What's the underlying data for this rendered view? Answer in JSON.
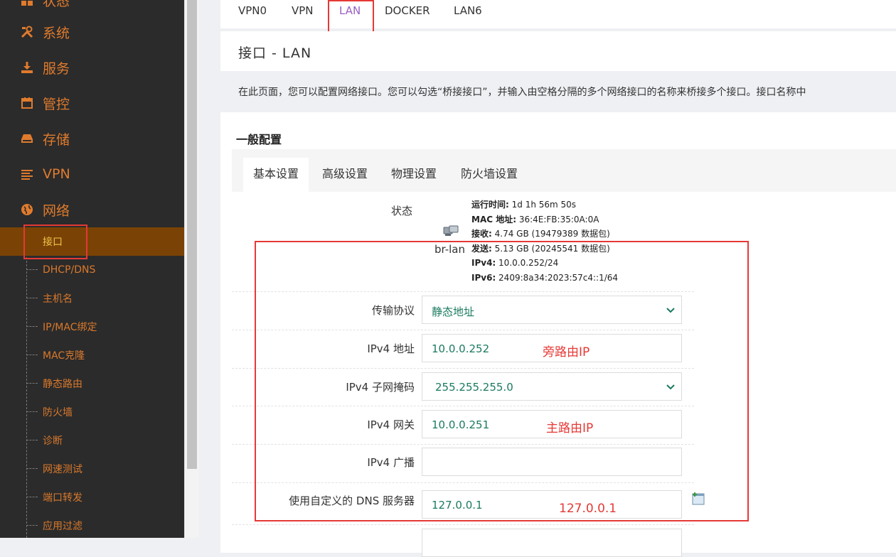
{
  "sidebar": {
    "items": [
      {
        "label": "状态",
        "icon": "dashboard-icon"
      },
      {
        "label": "系统",
        "icon": "tools-icon"
      },
      {
        "label": "服务",
        "icon": "download-icon"
      },
      {
        "label": "管控",
        "icon": "calendar-icon"
      },
      {
        "label": "存储",
        "icon": "drive-icon"
      },
      {
        "label": "VPN",
        "icon": "list-icon"
      },
      {
        "label": "网络",
        "icon": "globe-icon"
      }
    ],
    "sub_items": [
      "接口",
      "DHCP/DNS",
      "主机名",
      "IP/MAC绑定",
      "MAC克隆",
      "静态路由",
      "防火墙",
      "诊断",
      "网速测试",
      "端口转发",
      "应用过滤"
    ],
    "active_sub": "接口"
  },
  "tabs": [
    "VPN0",
    "VPN",
    "LAN",
    "DOCKER",
    "LAN6"
  ],
  "active_tab": "LAN",
  "page_title": "接口 - LAN",
  "description": "在此页面，您可以配置网络接口。您可以勾选“桥接接口”，并输入由空格分隔的多个网络接口的名称来桥接多个接口。接口名称中",
  "section_title": "一般配置",
  "subtabs": [
    "基本设置",
    "高级设置",
    "物理设置",
    "防火墙设置"
  ],
  "active_subtab": "基本设置",
  "status": {
    "label": "状态",
    "device": "br-lan",
    "lines": [
      {
        "key": "运行时间:",
        "value": " 1d 1h 56m 50s"
      },
      {
        "key": "MAC 地址:",
        "value": " 36:4E:FB:35:0A:0A"
      },
      {
        "key": "接收:",
        "value": " 4.74 GB (19479389 数据包)"
      },
      {
        "key": "发送:",
        "value": " 5.13 GB (20245541 数据包)"
      },
      {
        "key": "IPv4:",
        "value": " 10.0.0.252/24"
      },
      {
        "key": "IPv6:",
        "value": " 2409:8a34:2023:57c4::1/64"
      }
    ]
  },
  "form": {
    "protocol": {
      "label": "传输协议",
      "value": "静态地址"
    },
    "ipv4_addr": {
      "label": "IPv4 地址",
      "value": "10.0.0.252",
      "note": "旁路由IP"
    },
    "netmask": {
      "label": "IPv4 子网掩码",
      "value": "255.255.255.0"
    },
    "gateway": {
      "label": "IPv4 网关",
      "value": "10.0.0.251",
      "note": "主路由IP"
    },
    "broadcast": {
      "label": "IPv4 广播",
      "value": ""
    },
    "dns": {
      "label": "使用自定义的 DNS 服务器",
      "value": "127.0.0.1",
      "note": "127.0.0.1"
    }
  },
  "colors": {
    "accent": "#e07b2d",
    "active_bg": "#7a4305",
    "annotation": "#e53935",
    "value_text": "#1a7a5f"
  }
}
